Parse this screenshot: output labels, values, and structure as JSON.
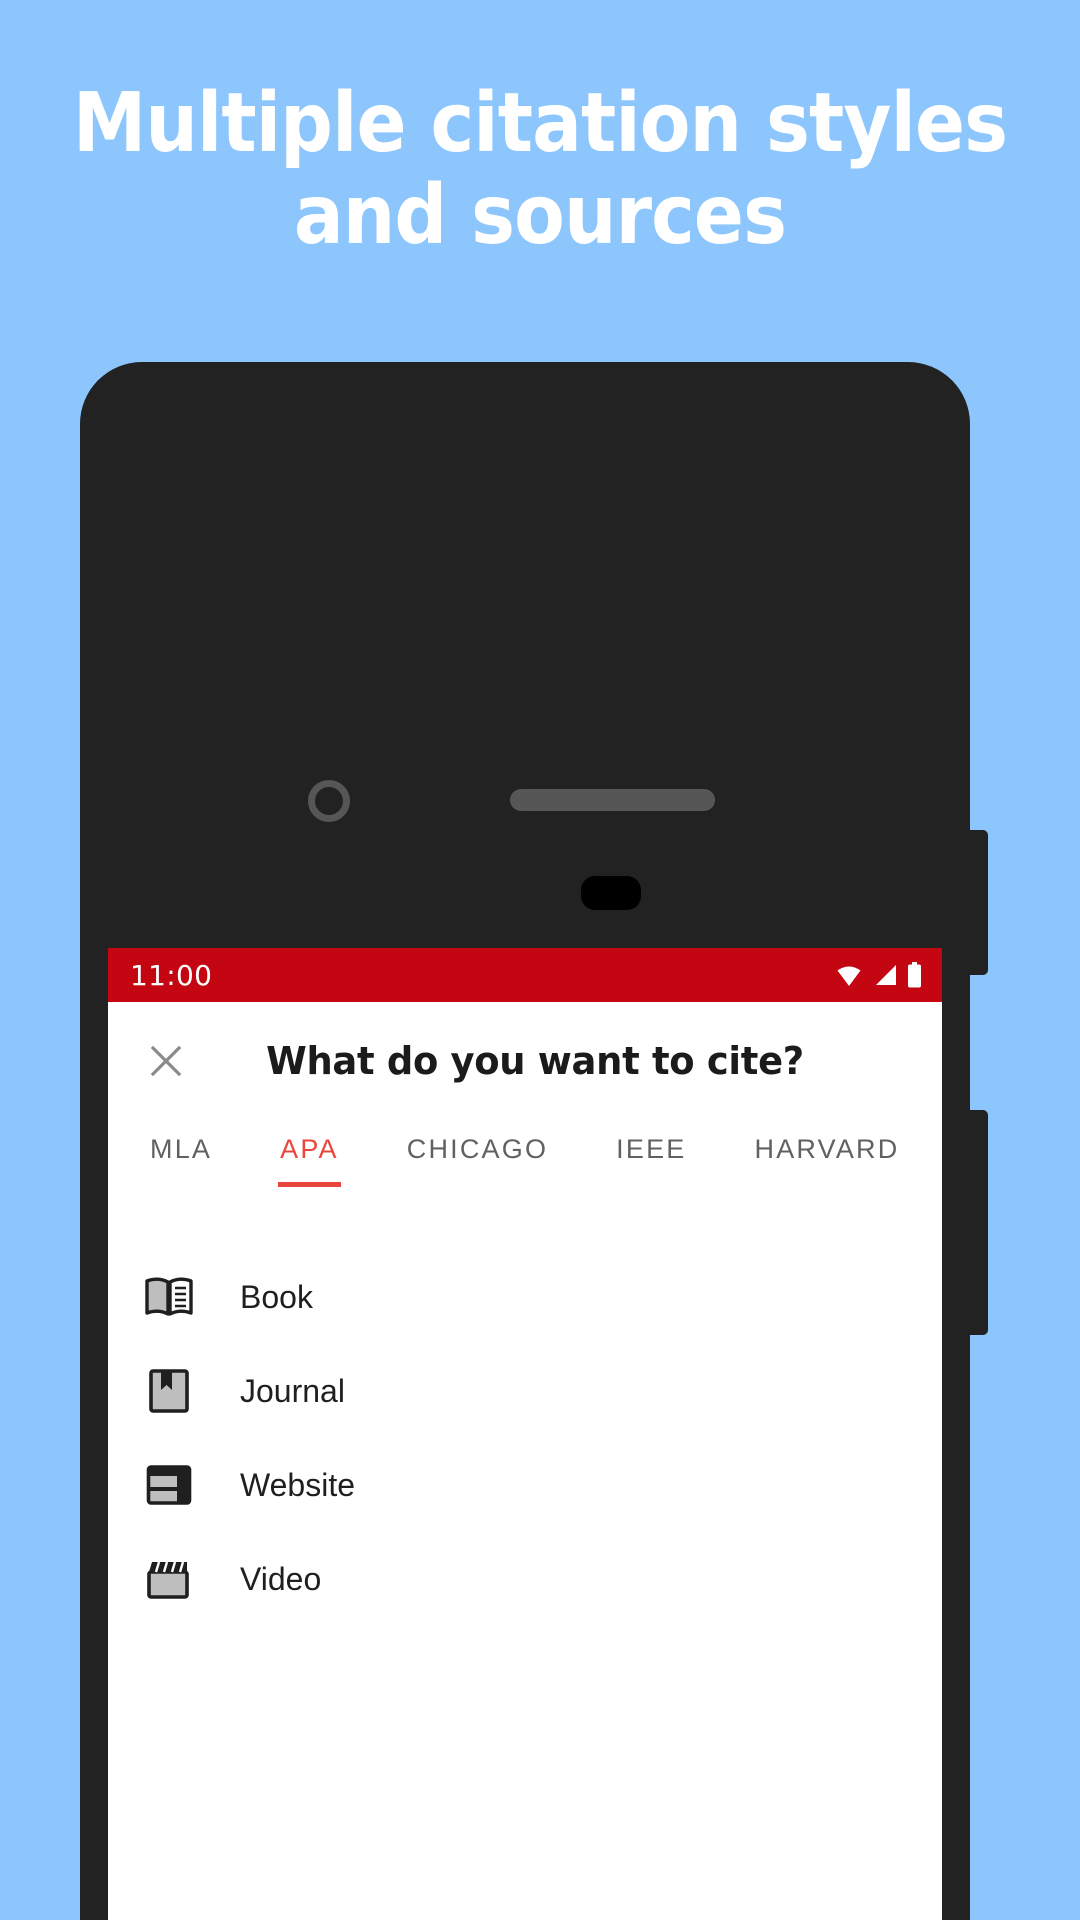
{
  "promo": {
    "headline": "Multiple citation styles\nand sources",
    "background_color": "#8CC6FC",
    "headline_color": "#FFFFFF"
  },
  "device": {
    "frame_color": "#222222",
    "camera_icon": "camera-lens-icon",
    "speaker_icon": "earpiece-speaker-icon",
    "sensor_icon": "proximity-sensor-icon",
    "volume_button": "volume-rocker-button",
    "power_button": "power-button"
  },
  "statusbar": {
    "time": "11:00",
    "background_color": "#C40612",
    "icons": [
      "wifi-icon",
      "signal-icon",
      "battery-icon"
    ]
  },
  "dialog": {
    "close_icon": "close-icon",
    "title": "What do you want to cite?",
    "accent_color": "#E8453C"
  },
  "tabs": {
    "selected": "APA",
    "items": [
      {
        "label": "MLA",
        "active": false
      },
      {
        "label": "APA",
        "active": true
      },
      {
        "label": "CHICAGO",
        "active": false
      },
      {
        "label": "IEEE",
        "active": false
      },
      {
        "label": "HARVARD",
        "active": false
      }
    ]
  },
  "source_list": {
    "items": [
      {
        "label": "Book",
        "icon": "open-book-icon"
      },
      {
        "label": "Journal",
        "icon": "bookmark-book-icon"
      },
      {
        "label": "Website",
        "icon": "website-layout-icon"
      },
      {
        "label": "Video",
        "icon": "clapperboard-icon"
      }
    ]
  }
}
